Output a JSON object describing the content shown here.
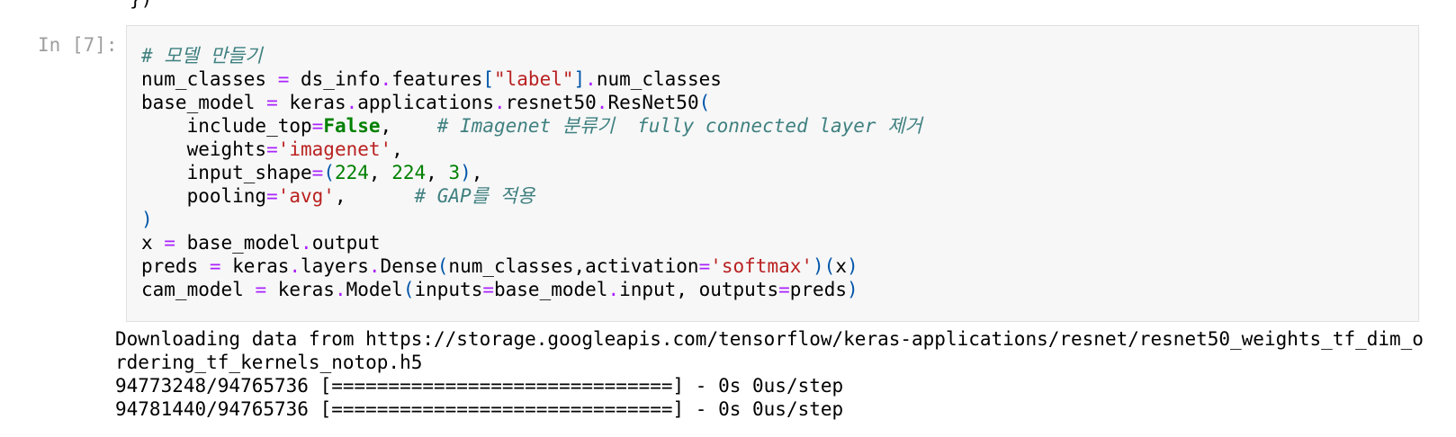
{
  "previous_cell": {
    "tail_text": "})"
  },
  "cell": {
    "prompt": "In [7]:",
    "code": {
      "l1_comment": "# 모델 만들기",
      "l2_a": "num_classes ",
      "l2_eq": "=",
      "l2_b": " ds_info",
      "l2_dot1": ".",
      "l2_c": "features",
      "l2_br1": "[",
      "l2_str": "\"label\"",
      "l2_br2": "]",
      "l2_dot2": ".",
      "l2_d": "num_classes",
      "l3_a": "base_model ",
      "l3_eq": "=",
      "l3_b": " keras",
      "l3_dot1": ".",
      "l3_c": "applications",
      "l3_dot2": ".",
      "l3_d": "resnet50",
      "l3_dot3": ".",
      "l3_e": "ResNet50",
      "l3_paren": "(",
      "l4_a": "    include_top",
      "l4_eq": "=",
      "l4_kw": "False",
      "l4_b": ",    ",
      "l4_comment": "# Imagenet 분류기  fully connected layer 제거",
      "l5_a": "    weights",
      "l5_eq": "=",
      "l5_str": "'imagenet'",
      "l5_b": ",",
      "l6_a": "    input_shape",
      "l6_eq": "=",
      "l6_p1": "(",
      "l6_n1": "224",
      "l6_c1": ", ",
      "l6_n2": "224",
      "l6_c2": ", ",
      "l6_n3": "3",
      "l6_p2": ")",
      "l6_b": ",",
      "l7_a": "    pooling",
      "l7_eq": "=",
      "l7_str": "'avg'",
      "l7_b": ",      ",
      "l7_comment": "# GAP를 적용",
      "l8_paren": ")",
      "l9_a": "x ",
      "l9_eq": "=",
      "l9_b": " base_model",
      "l9_dot": ".",
      "l9_c": "output",
      "l10_a": "preds ",
      "l10_eq": "=",
      "l10_b": " keras",
      "l10_dot1": ".",
      "l10_c": "layers",
      "l10_dot2": ".",
      "l10_d": "Dense",
      "l10_p1": "(",
      "l10_e": "num_classes,activation",
      "l10_eq2": "=",
      "l10_str": "'softmax'",
      "l10_p2": ")(",
      "l10_f": "x",
      "l10_p3": ")",
      "l11_a": "cam_model ",
      "l11_eq": "=",
      "l11_b": " keras",
      "l11_dot1": ".",
      "l11_c": "Model",
      "l11_p1": "(",
      "l11_d": "inputs",
      "l11_eq2": "=",
      "l11_e": "base_model",
      "l11_dot2": ".",
      "l11_f": "input, outputs",
      "l11_eq3": "=",
      "l11_g": "preds",
      "l11_p2": ")"
    }
  },
  "output": {
    "lines": [
      "Downloading data from https://storage.googleapis.com/tensorflow/keras-applications/resnet/resnet50_weights_tf_dim_o",
      "rdering_tf_kernels_notop.h5",
      "94773248/94765736 [==============================] - 0s 0us/step",
      "94781440/94765736 [==============================] - 0s 0us/step"
    ]
  }
}
